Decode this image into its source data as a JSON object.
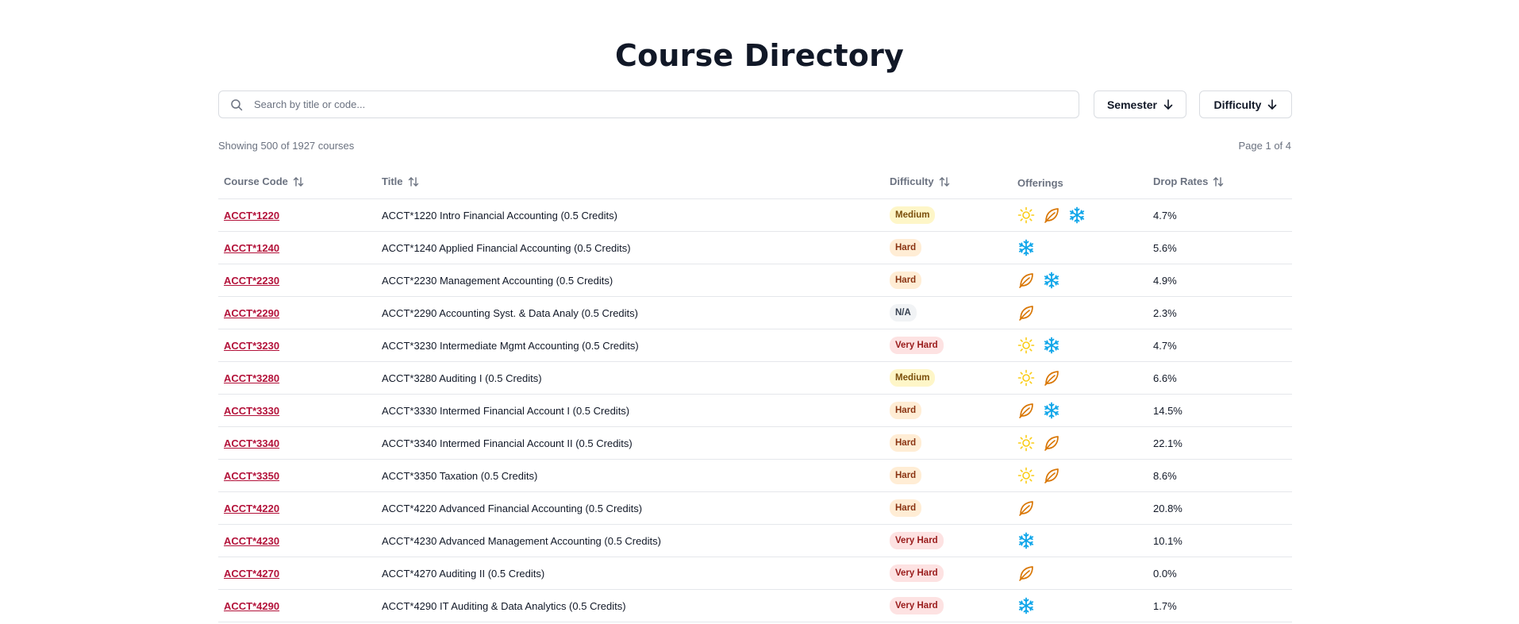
{
  "page": {
    "title": "Course Directory"
  },
  "search": {
    "placeholder": "Search by title or code..."
  },
  "filters": {
    "semester_label": "Semester",
    "difficulty_label": "Difficulty"
  },
  "summary": {
    "showing": "Showing 500 of 1927 courses",
    "page": "Page 1 of 4"
  },
  "table": {
    "headers": {
      "code": "Course Code",
      "title": "Title",
      "difficulty": "Difficulty",
      "offerings": "Offerings",
      "drop_rates": "Drop Rates"
    },
    "rows": [
      {
        "code": "ACCT*1220",
        "title": "ACCT*1220 Intro Financial Accounting (0.5 Credits)",
        "difficulty": "Medium",
        "offerings": [
          "summer",
          "fall",
          "winter"
        ],
        "drop_rate": "4.7%"
      },
      {
        "code": "ACCT*1240",
        "title": "ACCT*1240 Applied Financial Accounting (0.5 Credits)",
        "difficulty": "Hard",
        "offerings": [
          "winter"
        ],
        "drop_rate": "5.6%"
      },
      {
        "code": "ACCT*2230",
        "title": "ACCT*2230 Management Accounting (0.5 Credits)",
        "difficulty": "Hard",
        "offerings": [
          "fall",
          "winter"
        ],
        "drop_rate": "4.9%"
      },
      {
        "code": "ACCT*2290",
        "title": "ACCT*2290 Accounting Syst. & Data Analy (0.5 Credits)",
        "difficulty": "N/A",
        "offerings": [
          "fall"
        ],
        "drop_rate": "2.3%"
      },
      {
        "code": "ACCT*3230",
        "title": "ACCT*3230 Intermediate Mgmt Accounting (0.5 Credits)",
        "difficulty": "Very Hard",
        "offerings": [
          "summer",
          "winter"
        ],
        "drop_rate": "4.7%"
      },
      {
        "code": "ACCT*3280",
        "title": "ACCT*3280 Auditing I (0.5 Credits)",
        "difficulty": "Medium",
        "offerings": [
          "summer",
          "fall"
        ],
        "drop_rate": "6.6%"
      },
      {
        "code": "ACCT*3330",
        "title": "ACCT*3330 Intermed Financial Account I (0.5 Credits)",
        "difficulty": "Hard",
        "offerings": [
          "fall",
          "winter"
        ],
        "drop_rate": "14.5%"
      },
      {
        "code": "ACCT*3340",
        "title": "ACCT*3340 Intermed Financial Account II (0.5 Credits)",
        "difficulty": "Hard",
        "offerings": [
          "summer",
          "fall"
        ],
        "drop_rate": "22.1%"
      },
      {
        "code": "ACCT*3350",
        "title": "ACCT*3350 Taxation (0.5 Credits)",
        "difficulty": "Hard",
        "offerings": [
          "summer",
          "fall"
        ],
        "drop_rate": "8.6%"
      },
      {
        "code": "ACCT*4220",
        "title": "ACCT*4220 Advanced Financial Accounting (0.5 Credits)",
        "difficulty": "Hard",
        "offerings": [
          "fall"
        ],
        "drop_rate": "20.8%"
      },
      {
        "code": "ACCT*4230",
        "title": "ACCT*4230 Advanced Management Accounting (0.5 Credits)",
        "difficulty": "Very Hard",
        "offerings": [
          "winter"
        ],
        "drop_rate": "10.1%"
      },
      {
        "code": "ACCT*4270",
        "title": "ACCT*4270 Auditing II (0.5 Credits)",
        "difficulty": "Very Hard",
        "offerings": [
          "fall"
        ],
        "drop_rate": "0.0%"
      },
      {
        "code": "ACCT*4290",
        "title": "ACCT*4290 IT Auditing & Data Analytics (0.5 Credits)",
        "difficulty": "Very Hard",
        "offerings": [
          "winter"
        ],
        "drop_rate": "1.7%"
      }
    ]
  },
  "icons": {
    "summer": "sun-icon",
    "fall": "leaf-icon",
    "winter": "snowflake-icon",
    "search": "search-icon",
    "sort": "sort-icon",
    "dropdown": "arrow-down-icon"
  },
  "colors": {
    "code_link": "#b3123a",
    "summer": "#facc15",
    "fall": "#d97706",
    "winter": "#0ea5e9"
  }
}
